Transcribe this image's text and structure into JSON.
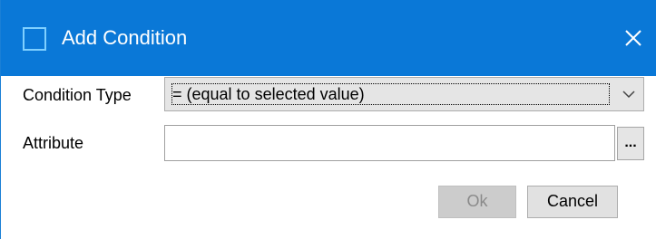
{
  "dialog": {
    "title": "Add Condition",
    "colors": {
      "titlebar": "#0a78d7",
      "title_icon_border": "#7fd0ff"
    }
  },
  "form": {
    "condition_type_label": "Condition Type",
    "condition_type_value": "= (equal to selected value)",
    "attribute_label": "Attribute",
    "attribute_value": "",
    "browse_label": "..."
  },
  "buttons": {
    "ok_label": "Ok",
    "ok_enabled": false,
    "cancel_label": "Cancel"
  },
  "icons": {
    "title": "window-icon",
    "close": "close-icon",
    "dropdown": "chevron-down-icon"
  }
}
